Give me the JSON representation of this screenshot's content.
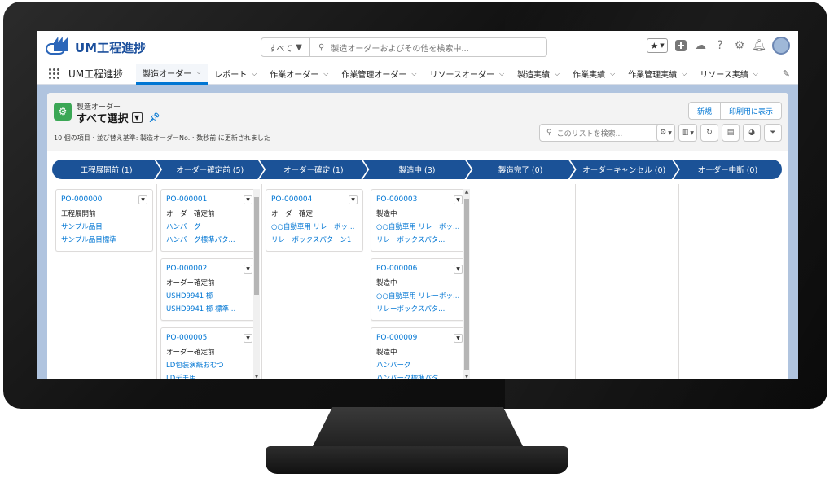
{
  "app": {
    "logo_text": "UM工程進捗",
    "name": "UM工程進捗"
  },
  "search": {
    "scope": "すべて",
    "placeholder": "製造オーダーおよびその他を検索中..."
  },
  "nav": {
    "items": [
      {
        "label": "製造オーダー",
        "active": true
      },
      {
        "label": "レポート"
      },
      {
        "label": "作業オーダー"
      },
      {
        "label": "作業管理オーダー"
      },
      {
        "label": "リソースオーダー"
      },
      {
        "label": "製造実績"
      },
      {
        "label": "作業実績"
      },
      {
        "label": "作業管理実績"
      },
      {
        "label": "リソース実績"
      }
    ]
  },
  "list": {
    "object_label": "製造オーダー",
    "view_name": "すべて選択",
    "meta": "10 個の項目・並び替え基準: 製造オーダーNo.・数秒前 に更新されました",
    "search_placeholder": "このリストを検索...",
    "new_label": "新規",
    "print_label": "印刷用に表示"
  },
  "stages": [
    {
      "label": "工程展開前 (1)"
    },
    {
      "label": "オーダー確定前 (5)"
    },
    {
      "label": "オーダー確定 (1)"
    },
    {
      "label": "製造中 (3)"
    },
    {
      "label": "製造完了 (0)"
    },
    {
      "label": "オーダーキャンセル (0)"
    },
    {
      "label": "オーダー中断 (0)"
    }
  ],
  "columns": [
    {
      "cards": [
        {
          "id": "PO-000000",
          "status": "工程展開前",
          "item": "サンプル品目",
          "pattern": "サンプル品目標準"
        }
      ]
    },
    {
      "cards": [
        {
          "id": "PO-000001",
          "status": "オーダー確定前",
          "item": "ハンバーグ",
          "pattern": "ハンバーグ標準パタ..."
        },
        {
          "id": "PO-000002",
          "status": "オーダー確定前",
          "item": "USHD9941 櫛",
          "pattern": "USHD9941 櫛 標準..."
        },
        {
          "id": "PO-000005",
          "status": "オーダー確定前",
          "item": "LD包装演紙おむつ",
          "pattern": "LDデモ用"
        }
      ]
    },
    {
      "cards": [
        {
          "id": "PO-000004",
          "status": "オーダー確定",
          "item": "○○自動車用 リレーボックス...",
          "pattern": "リレーボックスパターン1"
        }
      ]
    },
    {
      "cards": [
        {
          "id": "PO-000003",
          "status": "製造中",
          "item": "○○自動車用 リレーボッ...",
          "pattern": "リレーボックスパタ..."
        },
        {
          "id": "PO-000006",
          "status": "製造中",
          "item": "○○自動車用 リレーボッ...",
          "pattern": "リレーボックスパタ..."
        },
        {
          "id": "PO-000009",
          "status": "製造中",
          "item": "ハンバーグ",
          "pattern": "ハンバーグ標準パタ..."
        }
      ]
    },
    {
      "cards": []
    },
    {
      "cards": []
    },
    {
      "cards": []
    }
  ],
  "icons": {
    "search": "search-icon",
    "favorites": "star-icon",
    "add": "plus-icon",
    "trailhead": "cloud-icon",
    "help": "help-icon",
    "setup": "gear-icon",
    "notifications": "bell-icon",
    "pin": "pin-icon",
    "edit": "pencil-icon"
  },
  "colors": {
    "stage_bar": "#1b5297",
    "link": "#0176d3",
    "object_icon": "#3ba755",
    "background": "#b0c4df"
  }
}
